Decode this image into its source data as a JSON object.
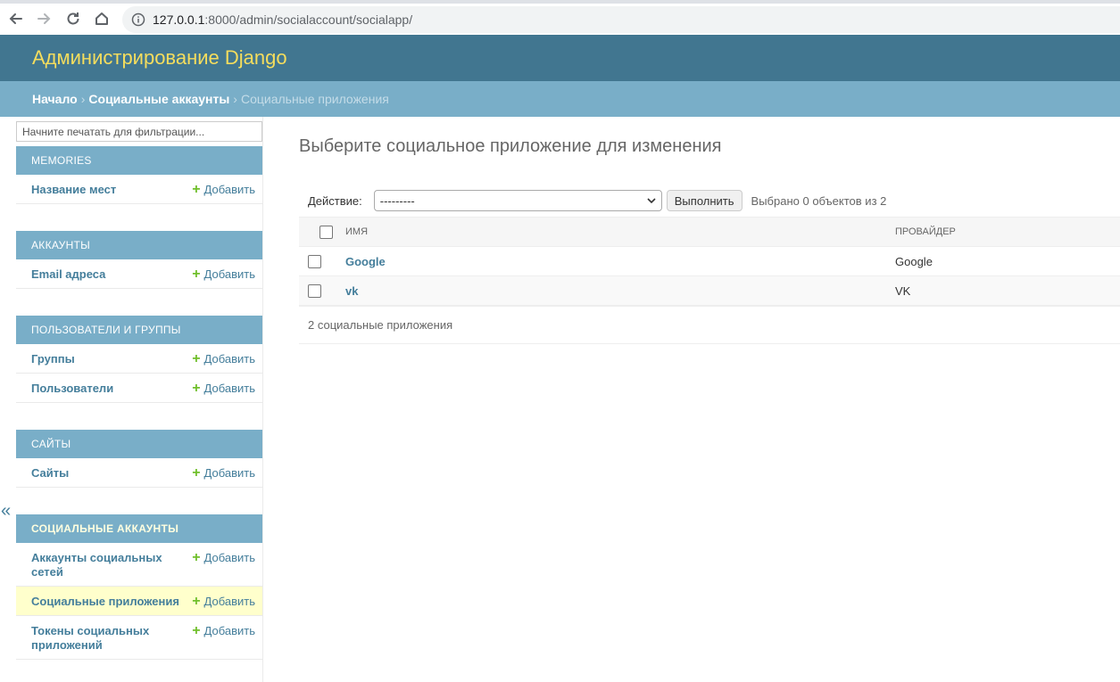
{
  "browser": {
    "url_host": "127.0.0.1",
    "url_path": ":8000/admin/socialaccount/socialapp/"
  },
  "header": {
    "site_title": "Администрирование Django"
  },
  "breadcrumbs": {
    "home": "Начало",
    "app": "Социальные аккаунты",
    "current": "Социальные приложения"
  },
  "sidebar": {
    "filter_placeholder": "Начните печатать для фильтрации...",
    "add_label": "Добавить",
    "collapse_label": "«",
    "modules": [
      {
        "caption": "Memories",
        "models": [
          {
            "name": "Название мест"
          }
        ]
      },
      {
        "caption": "Аккаунты",
        "models": [
          {
            "name": "Email адреса"
          }
        ]
      },
      {
        "caption": "Пользователи и группы",
        "models": [
          {
            "name": "Группы"
          },
          {
            "name": "Пользователи"
          }
        ]
      },
      {
        "caption": "Сайты",
        "models": [
          {
            "name": "Сайты"
          }
        ]
      },
      {
        "caption": "Социальные аккаунты",
        "models": [
          {
            "name": "Аккаунты социальных сетей"
          },
          {
            "name": "Социальные приложения"
          },
          {
            "name": "Токены социальных приложений"
          }
        ]
      }
    ]
  },
  "content": {
    "title": "Выберите социальное приложение для изменения",
    "action_label": "Действие:",
    "action_selected": "---------",
    "go_label": "Выполнить",
    "selected_count": "Выбрано 0 объектов из 2",
    "columns": [
      "Имя",
      "Провайдер"
    ],
    "rows": [
      {
        "name": "Google",
        "provider": "Google"
      },
      {
        "name": "vk",
        "provider": "VK"
      }
    ],
    "result_count": "2 социальные приложения"
  },
  "colors": {
    "header_bg": "#417690",
    "breadcrumbs_bg": "#79aec8",
    "title_yellow": "#f5dd5d",
    "link_blue": "#447e9b",
    "add_green": "#70bf2b",
    "current_row_bg": "#ffffcc"
  }
}
